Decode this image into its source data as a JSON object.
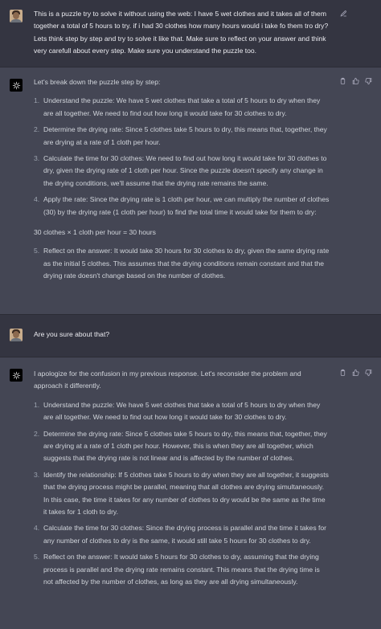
{
  "conversation": {
    "user1": {
      "text": "This is a puzzle try to solve it without using the web: I have 5 wet clothes and it takes all of them together a total of 5 hours to try. if i had 30 clothes how many hours would i take fo them tro dry? Lets think step by step and try to solve it like that. Make sure to reflect on your answer and think very carefull about every step. Make sure you understand the puzzle too."
    },
    "bot1": {
      "intro": "Let's break down the puzzle step by step:",
      "steps": [
        {
          "n": "1.",
          "text": "Understand the puzzle: We have 5 wet clothes that take a total of 5 hours to dry when they are all together. We need to find out how long it would take for 30 clothes to dry."
        },
        {
          "n": "2.",
          "text": "Determine the drying rate: Since 5 clothes take 5 hours to dry, this means that, together, they are drying at a rate of 1 cloth per hour."
        },
        {
          "n": "3.",
          "text": "Calculate the time for 30 clothes: We need to find out how long it would take for 30 clothes to dry, given the drying rate of 1 cloth per hour. Since the puzzle doesn't specify any change in the drying conditions, we'll assume that the drying rate remains the same."
        },
        {
          "n": "4.",
          "text": "Apply the rate: Since the drying rate is 1 cloth per hour, we can multiply the number of clothes (30) by the drying rate (1 cloth per hour) to find the total time it would take for them to dry:"
        }
      ],
      "formula": "30 clothes × 1 cloth per hour = 30 hours",
      "steps2": [
        {
          "n": "5.",
          "text": "Reflect on the answer: It would take 30 hours for 30 clothes to dry, given the same drying rate as the initial 5 clothes. This assumes that the drying conditions remain constant and that the drying rate doesn't change based on the number of clothes."
        }
      ]
    },
    "user2": {
      "text": "Are you sure about that?"
    },
    "bot2": {
      "intro": "I apologize for the confusion in my previous response. Let's reconsider the problem and approach it differently.",
      "steps": [
        {
          "n": "1.",
          "text": "Understand the puzzle: We have 5 wet clothes that take a total of 5 hours to dry when they are all together. We need to find out how long it would take for 30 clothes to dry."
        },
        {
          "n": "2.",
          "text": "Determine the drying rate: Since 5 clothes take 5 hours to dry, this means that, together, they are drying at a rate of 1 cloth per hour. However, this is when they are all together, which suggests that the drying rate is not linear and is affected by the number of clothes."
        },
        {
          "n": "3.",
          "text": "Identify the relationship: If 5 clothes take 5 hours to dry when they are all together, it suggests that the drying process might be parallel, meaning that all clothes are drying simultaneously. In this case, the time it takes for any number of clothes to dry would be the same as the time it takes for 1 cloth to dry."
        },
        {
          "n": "4.",
          "text": "Calculate the time for 30 clothes: Since the drying process is parallel and the time it takes for any number of clothes to dry is the same, it would still take 5 hours for 30 clothes to dry."
        },
        {
          "n": "5.",
          "text": "Reflect on the answer: It would take 5 hours for 30 clothes to dry, assuming that the drying process is parallel and the drying rate remains constant. This means that the drying time is not affected by the number of clothes, as long as they are all drying simultaneously."
        }
      ]
    }
  },
  "icons": {
    "edit": "edit-icon",
    "copy": "clipboard-icon",
    "like": "thumbs-up-icon",
    "dislike": "thumbs-down-icon",
    "bot_logo": "openai-logo-icon",
    "user_avatar": "user-avatar"
  },
  "colors": {
    "user_bg": "#343541",
    "bot_bg": "#444654",
    "text": "#d1d5db",
    "icon": "#acacbe"
  }
}
